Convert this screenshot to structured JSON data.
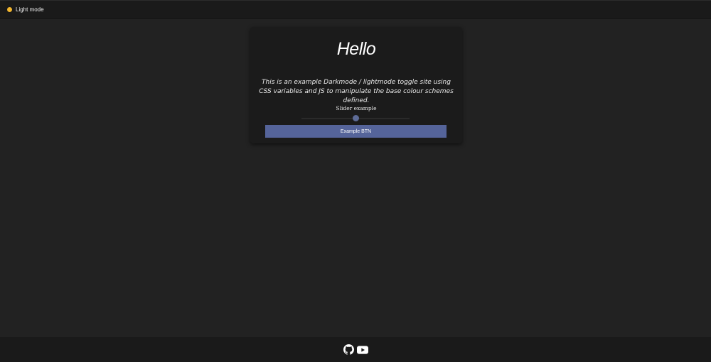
{
  "header": {
    "mode_toggle_label": "Light mode",
    "mode_indicator_color": "#f2b62e"
  },
  "card": {
    "title": "Hello",
    "description": "This is an example Darkmode / lightmode toggle site using CSS variables and JS to manipulate the base colour schemes defined.",
    "slider": {
      "label": "Slider example",
      "value_fraction": 0.5
    },
    "button_label": "Example BTN",
    "button_color": "#55649a"
  },
  "footer": {
    "links": [
      {
        "icon": "github-icon"
      },
      {
        "icon": "youtube-icon"
      }
    ]
  },
  "colors": {
    "background": "#222222",
    "card": "#1b1b1b",
    "bars": "#1a1a1a"
  }
}
